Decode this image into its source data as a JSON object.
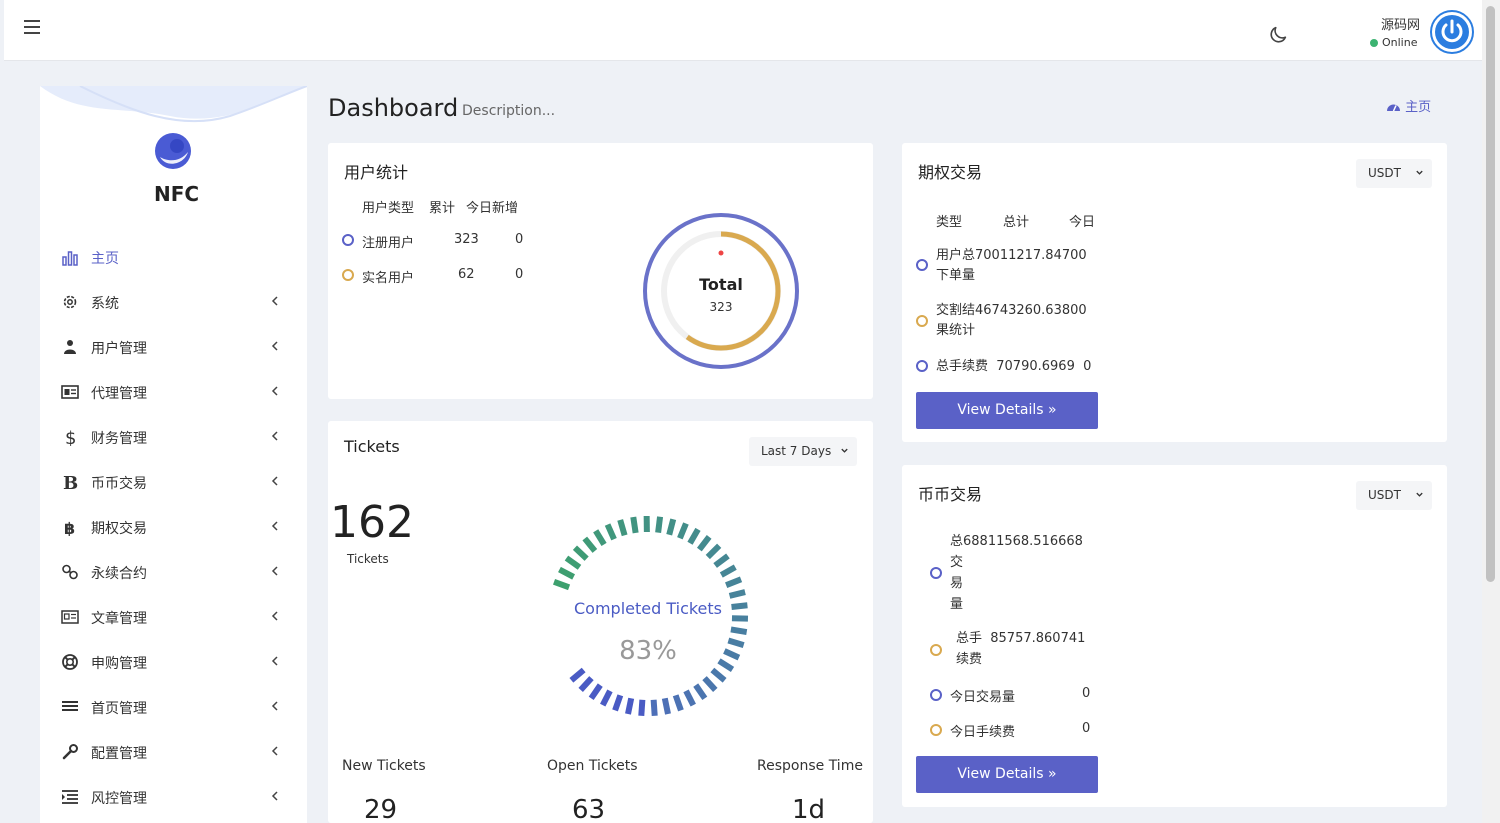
{
  "header": {
    "user_name": "源码网",
    "status": "Online"
  },
  "brand": "NFC",
  "sidebar": {
    "items": [
      {
        "label": "主页",
        "icon": "bar-chart-icon",
        "active": true
      },
      {
        "label": "系统",
        "icon": "gear-icon"
      },
      {
        "label": "用户管理",
        "icon": "users-icon"
      },
      {
        "label": "代理管理",
        "icon": "id-card-icon"
      },
      {
        "label": "财务管理",
        "icon": "dollar-icon"
      },
      {
        "label": "币币交易",
        "icon": "bitcoin-b-icon"
      },
      {
        "label": "期权交易",
        "icon": "bitcoin-icon"
      },
      {
        "label": "永续合约",
        "icon": "link-icon"
      },
      {
        "label": "文章管理",
        "icon": "newspaper-icon"
      },
      {
        "label": "申购管理",
        "icon": "lifebuoy-icon"
      },
      {
        "label": "首页管理",
        "icon": "list-icon"
      },
      {
        "label": "配置管理",
        "icon": "wrench-icon"
      },
      {
        "label": "风控管理",
        "icon": "indent-icon"
      }
    ]
  },
  "page": {
    "title": "Dashboard",
    "description": "Description...",
    "breadcrumb": "主页"
  },
  "user_stats": {
    "title": "用户统计",
    "headers": [
      "用户类型",
      "累计",
      "今日新增"
    ],
    "rows": [
      {
        "type": "注册用户",
        "total": "323",
        "today": "0"
      },
      {
        "type": "实名用户",
        "total": "62",
        "today": "0"
      }
    ],
    "donut_label": "Total",
    "donut_value": "323"
  },
  "tickets": {
    "title": "Tickets",
    "period": "Last 7 Days",
    "count": "162",
    "count_label": "Tickets",
    "gauge_label": "Completed Tickets",
    "gauge_value": "83%",
    "completed_fraction": 0.83,
    "stats": [
      {
        "label": "New Tickets",
        "value": "29"
      },
      {
        "label": "Open Tickets",
        "value": "63"
      },
      {
        "label": "Response Time",
        "value": "1d"
      }
    ]
  },
  "options_trading": {
    "title": "期权交易",
    "currency": "USDT",
    "headers": [
      "类型",
      "总计",
      "今日"
    ],
    "rows": [
      {
        "text": "用户总70011217.84700",
        "text2": "下单量"
      },
      {
        "text": "交割结46743260.63800",
        "text2": "果统计"
      },
      {
        "text": "总手续费  70790.6969  0",
        "text2": ""
      }
    ],
    "button": "View Details"
  },
  "coin_trading": {
    "title": "币币交易",
    "currency": "USDT",
    "rows": [
      {
        "lines": [
          "总68811568.516668",
          "交",
          "易",
          "量"
        ],
        "today": ""
      },
      {
        "lines": [
          "总手  85757.860741",
          "续费"
        ],
        "today": ""
      },
      {
        "lines": [
          "今日交易量"
        ],
        "today": "0"
      },
      {
        "lines": [
          "今日手续费"
        ],
        "today": "0"
      }
    ],
    "button": "View Details"
  },
  "colors": {
    "primary": "#5a61c7",
    "gold": "#d9a94f",
    "green": "#3d9a74"
  }
}
